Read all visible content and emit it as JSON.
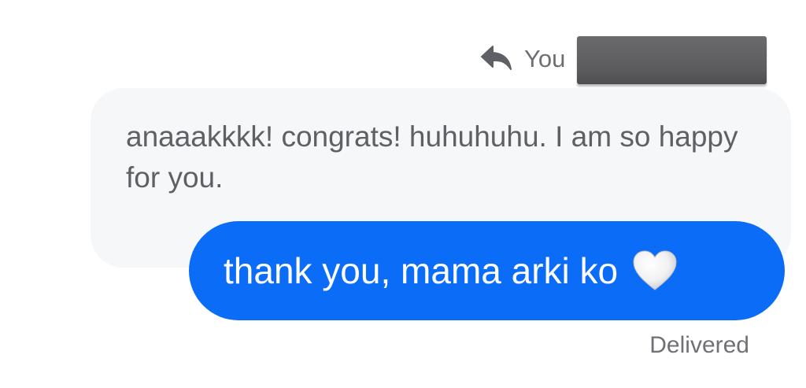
{
  "reply_header": {
    "icon": "reply-arrow-icon",
    "label": "You"
  },
  "quoted_message": {
    "text": "anaaakkkk! congrats! huhuhuhu. I am so happy for you."
  },
  "sent_message": {
    "text": "thank you, mama arki ko",
    "emoji": "white-heart-icon"
  },
  "status": {
    "text": "Delivered"
  },
  "colors": {
    "sent_bubble": "#0b6cf7",
    "quoted_bubble": "#f6f7f9",
    "secondary_text": "#6e6e73",
    "redaction": "#5c5c5e"
  }
}
